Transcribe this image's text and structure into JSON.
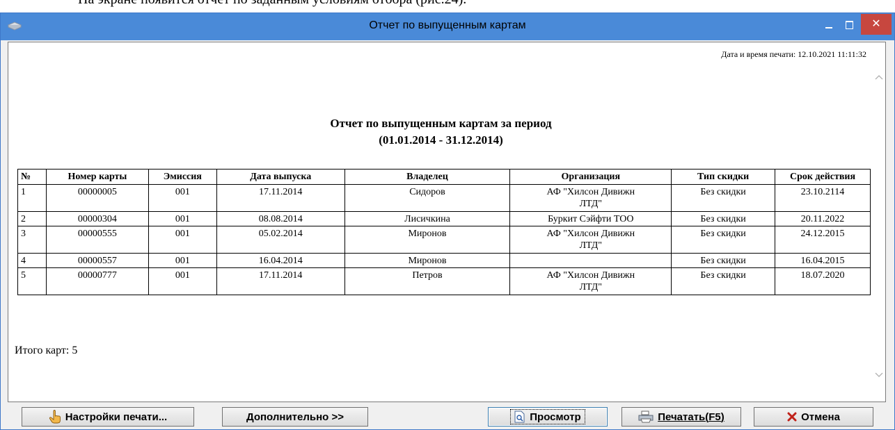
{
  "document": {
    "partial_line": "На экране появится отчет по заданным условиям отбора (рис.24)."
  },
  "window": {
    "title": "Отчет по выпущенным картам",
    "close_glyph": "✕"
  },
  "report": {
    "print_datetime": "Дата и время печати: 12.10.2021 11:11:32",
    "title": "Отчет по выпущенным картам за период",
    "period": "(01.01.2014 - 31.12.2014)",
    "columns": [
      "№",
      "Номер карты",
      "Эмиссия",
      "Дата выпуска",
      "Владелец",
      "Организация",
      "Тип скидки",
      "Срок действия"
    ],
    "rows": [
      [
        "1",
        "00000005",
        "001",
        "17.11.2014",
        "Сидоров",
        "АФ \"Хилсон Дивижн ЛТД\"",
        "Без скидки",
        "23.10.2114"
      ],
      [
        "2",
        "00000304",
        "001",
        "08.08.2014",
        "Лисичкина",
        "Буркит Сэйфти ТОО",
        "Без скидки",
        "20.11.2022"
      ],
      [
        "3",
        "00000555",
        "001",
        "05.02.2014",
        "Миронов",
        "АФ \"Хилсон Дивижн ЛТД\"",
        "Без скидки",
        "24.12.2015"
      ],
      [
        "4",
        "00000557",
        "001",
        "16.04.2014",
        "Миронов",
        "",
        "Без скидки",
        "16.04.2015"
      ],
      [
        "5",
        "00000777",
        "001",
        "17.11.2014",
        "Петров",
        "АФ \"Хилсон Дивижн ЛТД\"",
        "Без скидки",
        "18.07.2020"
      ]
    ],
    "total": "Итого карт: 5"
  },
  "buttons": {
    "print_settings": "Настройки печати...",
    "more": "Дополнительно >>",
    "preview": "Просмотр",
    "print": "Печатать(F5)",
    "cancel": "Отмена"
  },
  "colors": {
    "titlebar": "#4a8ad8",
    "close": "#c7473f",
    "cancel_icon": "#c0221a"
  }
}
